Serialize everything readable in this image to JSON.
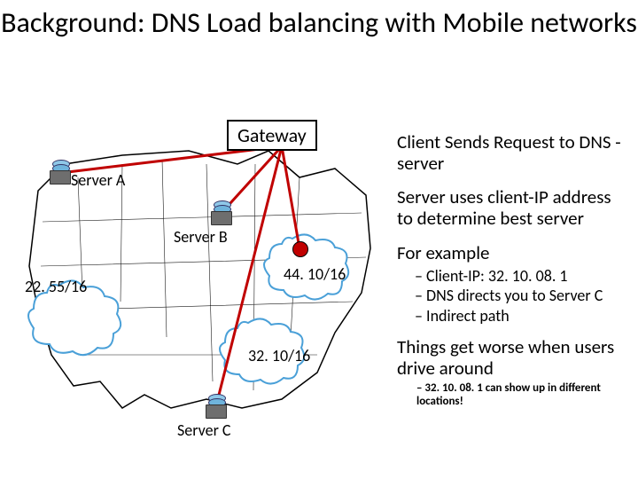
{
  "title": "Background: DNS Load balancing with Mobile networks",
  "map": {
    "gateway_label": "Gateway",
    "server_a_label": "Server A",
    "server_b_label": "Server B",
    "server_c_label": "Server C",
    "cidr_a": "22. 55/16",
    "cidr_b": "44. 10/16",
    "cidr_c": "32. 10/16"
  },
  "text": {
    "p1": "Client Sends Request to DNS -server",
    "p2": "Server uses client-IP address to determine best server",
    "p3": "For example",
    "ex1": "Client-IP: 32. 10. 08. 1",
    "ex2": "DNS directs you to Server C",
    "ex3": "Indirect path",
    "p4": "Things get worse when users drive around",
    "worse1": "32. 10. 08. 1 can show up in different locations!"
  }
}
